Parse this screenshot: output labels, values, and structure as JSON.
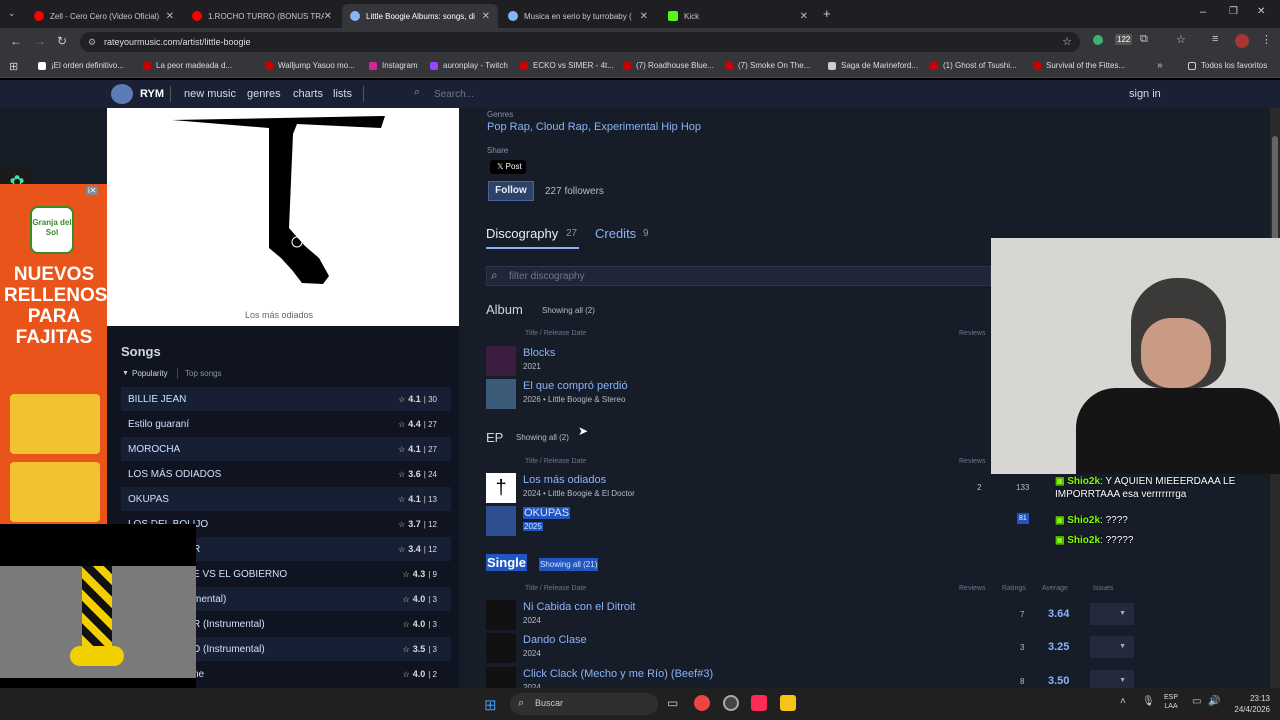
{
  "browser": {
    "tabs": [
      {
        "title": "Zell - Cero Cero (Video Oficial)",
        "color": "#ff0000"
      },
      {
        "title": "1.ROCHO TURRO (BONUS TRA",
        "color": "#ff0000"
      },
      {
        "title": "Little Boogie Albums: songs, di",
        "color": "#5b6b8c"
      },
      {
        "title": "Musica en serio by turrobaby (",
        "color": "#5b6b8c"
      },
      {
        "title": "Kick",
        "color": "#53fc18"
      }
    ],
    "url": "rateyourmusic.com/artist/little-boogie",
    "bookmarks": [
      "¡El orden definitivo...",
      "La peor madeada d...",
      "Walljump Yasuo mo...",
      "Instagram",
      "auronplay - Twitch",
      "ECKO vs SIMER - 4t...",
      "(7) Roadhouse Blue...",
      "(7) Smoke On The...",
      "Saga de Marineford...",
      "(1) Ghost of Tsushi...",
      "Survival of the Fittes..."
    ],
    "bookmarks_all": "Todos los favoritos"
  },
  "site": {
    "logo": "RYM",
    "nav": [
      "new music",
      "genres",
      "charts",
      "lists"
    ],
    "search_placeholder": "Search...",
    "signin": "sign in"
  },
  "artist": {
    "cover_caption": "Los más odiados",
    "genres_label": "Genres",
    "genres": "Pop Rap, Cloud Rap, Experimental Hip Hop",
    "share_label": "Share",
    "post_label": "Post",
    "follow_label": "Follow",
    "followers": "227 followers"
  },
  "songs": {
    "title": "Songs",
    "sort_active": "Popularity",
    "sort_other": "Top songs",
    "items": [
      {
        "name": "BILLIE JEAN",
        "rating": "4.1",
        "count": "30"
      },
      {
        "name": "Estilo guaraní",
        "rating": "4.4",
        "count": "27"
      },
      {
        "name": "MOROCHA",
        "rating": "4.1",
        "count": "27"
      },
      {
        "name": "LOS MÁS ODIADOS",
        "rating": "3.6",
        "count": "24"
      },
      {
        "name": "OKUPAS",
        "rating": "4.1",
        "count": "13"
      },
      {
        "name": "LOS DEL BOLIJO",
        "rating": "3.7",
        "count": "12"
      },
      {
        "name": "R",
        "rating": "3.4",
        "count": "12"
      },
      {
        "name": "E VS EL GOBIERNO",
        "rating": "4.3",
        "count": "9"
      },
      {
        "name": "mental)",
        "rating": "4.0",
        "count": "3"
      },
      {
        "name": "R (Instrumental)",
        "rating": "4.0",
        "count": "3"
      },
      {
        "name": "D (Instrumental)",
        "rating": "3.5",
        "count": "3"
      },
      {
        "name": "ne",
        "rating": "4.0",
        "count": "2"
      }
    ]
  },
  "discography": {
    "tab_disc": "Discography",
    "tab_disc_count": "27",
    "tab_credits": "Credits",
    "tab_credits_count": "9",
    "filter_placeholder": "filter discography",
    "col_title": "Title",
    "col_date": "Release Date",
    "col_reviews": "Reviews",
    "col_ratings": "Ratings",
    "col_average": "Average",
    "col_issues": "Issues",
    "album": {
      "label": "Album",
      "showing": "Showing all (2)",
      "items": [
        {
          "title": "Blocks",
          "sub": "2021"
        },
        {
          "title": "El que compró perdió",
          "sub": "2026 • Little Boogie & Stereo"
        }
      ]
    },
    "ep": {
      "label": "EP",
      "showing": "Showing all (2)",
      "items": [
        {
          "title": "Los más odiados",
          "sub": "2024 • Little Boogie & El Doctor",
          "reviews": "2",
          "ratings": "133"
        },
        {
          "title": "OKUPAS",
          "sub": "2025",
          "ratings": "81"
        }
      ]
    },
    "single": {
      "label": "Single",
      "showing": "Showing all (21)",
      "items": [
        {
          "title": "Ni Cabida con el Ditroit",
          "sub": "2024",
          "ratings": "7",
          "average": "3.64"
        },
        {
          "title": "Dando Clase",
          "sub": "2024",
          "ratings": "3",
          "average": "3.25"
        },
        {
          "title": "Click Clack (Mecho y me Río) (Beef#3)",
          "sub": "2024",
          "ratings": "8",
          "average": "3.50"
        }
      ]
    }
  },
  "ad": {
    "brand": "Granja del Sol",
    "headline": "NUEVOS RELLENOS PARA FAJITAS"
  },
  "chat": [
    {
      "user": "Shio2k",
      "msg": ": Y AQUIEN MIEEERDAAA LE IMPORRTAAA esa verrrrrrrga"
    },
    {
      "user": "Shio2k",
      "msg": ": ????"
    },
    {
      "user": "Shio2k",
      "msg": ": ?????"
    }
  ],
  "taskbar": {
    "search": "Buscar",
    "lang1": "ESP",
    "lang2": "LAA",
    "time": "23:13",
    "date": "24/4/2026"
  }
}
